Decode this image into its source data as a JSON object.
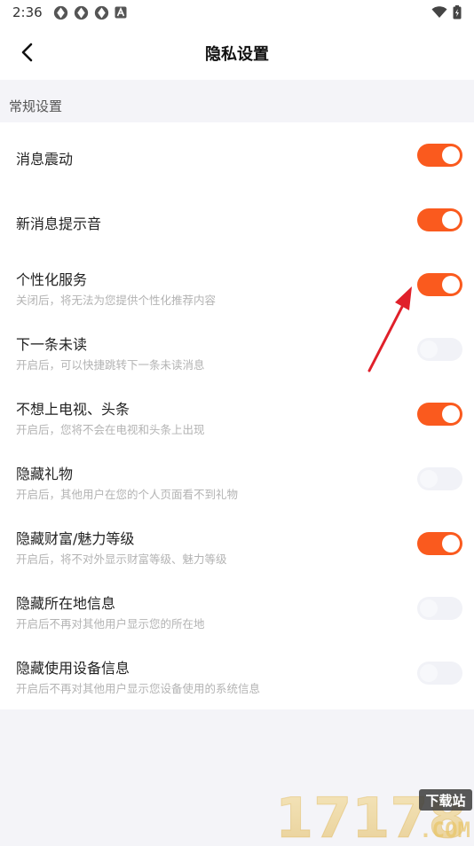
{
  "status_bar": {
    "time": "2:36",
    "notification_icons": [
      "app-icon",
      "app-icon",
      "app-icon",
      "a-icon"
    ],
    "right_icons": [
      "wifi-icon",
      "battery-icon"
    ]
  },
  "header": {
    "back_icon": "chevron-left-icon",
    "title": "隐私设置"
  },
  "section": {
    "title": "常规设置"
  },
  "settings": [
    {
      "label": "消息震动",
      "desc": "",
      "on": true
    },
    {
      "label": "新消息提示音",
      "desc": "",
      "on": true
    },
    {
      "label": "个性化服务",
      "desc": "关闭后，将无法为您提供个性化推荐内容",
      "on": true
    },
    {
      "label": "下一条未读",
      "desc": "开启后，可以快捷跳转下一条未读消息",
      "on": false
    },
    {
      "label": "不想上电视、头条",
      "desc": "开启后，您将不会在电视和头条上出现",
      "on": true
    },
    {
      "label": "隐藏礼物",
      "desc": "开启后，其他用户在您的个人页面看不到礼物",
      "on": false
    },
    {
      "label": "隐藏财富/魅力等级",
      "desc": "开启后，将不对外显示财富等级、魅力等级",
      "on": true
    },
    {
      "label": "隐藏所在地信息",
      "desc": "开启后不再对其他用户显示您的所在地",
      "on": false
    },
    {
      "label": "隐藏使用设备信息",
      "desc": "开启后不再对其他用户显示您设备使用的系统信息",
      "on": false
    }
  ],
  "colors": {
    "toggle_on": "#fa5a1e",
    "toggle_off": "#f1f2f7",
    "annotation_arrow": "#e0202a"
  },
  "watermark": {
    "number": "17178",
    "label": "下载站",
    "domain": ".COM"
  }
}
